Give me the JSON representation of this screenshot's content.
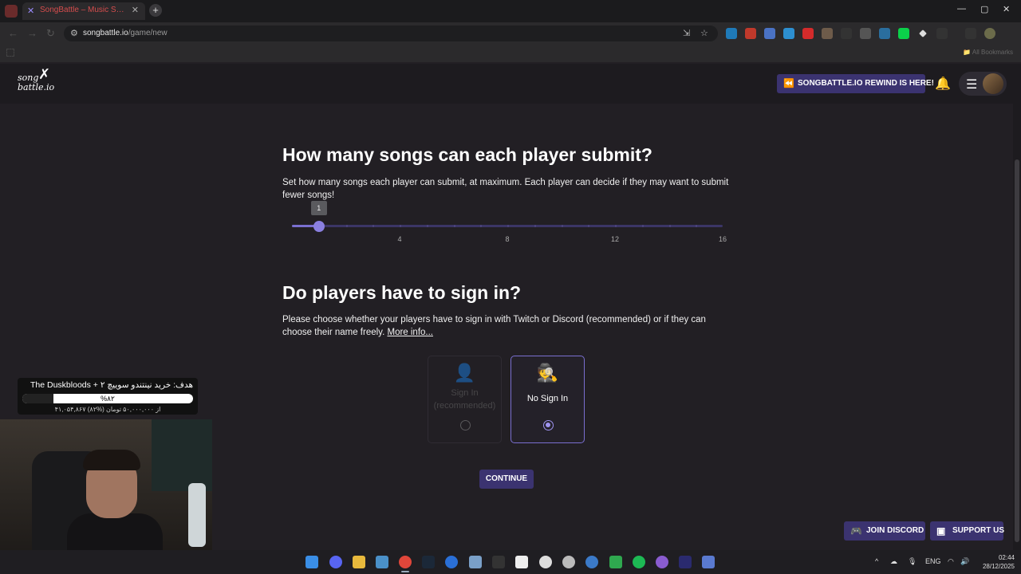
{
  "browser": {
    "tab_title": "SongBattle – Music Song Battle",
    "url_host": "songbattle.io",
    "url_path": "/game/new",
    "all_bookmarks": "All Bookmarks",
    "window_controls": {
      "minimize": "—",
      "maximize": "▢",
      "close": "✕"
    }
  },
  "site": {
    "logo_text_1": "song",
    "logo_text_2": "battle.io",
    "rewind_label": "SONGBATTLE.IO REWIND IS HERE!",
    "icons": {
      "rewind": "rewind-icon",
      "bell": "bell-icon",
      "menu": "menu-icon"
    }
  },
  "songs_section": {
    "title": "How many songs can each player submit?",
    "description": "Set how many songs each player can submit, at maximum. Each player can decide if they may want to submit fewer songs!",
    "slider": {
      "min": 0,
      "max": 16,
      "value": 1,
      "value_label": "1",
      "marks": [
        "4",
        "8",
        "12",
        "16"
      ]
    }
  },
  "signin_section": {
    "title": "Do players have to sign in?",
    "description": "Please choose whether your players have to sign in with Twitch or Discord (recommended) or if they can choose their name freely.",
    "more_info": "More info...",
    "options": [
      {
        "label": "Sign In (recommended)",
        "icon": "user-icon",
        "selected": false,
        "disabled": true
      },
      {
        "label": "No Sign In",
        "icon": "incognito-icon",
        "selected": true,
        "disabled": false
      }
    ],
    "continue_label": "CONTINUE"
  },
  "footer": {
    "join_discord": "JOIN DISCORD",
    "support_us": "SUPPORT US"
  },
  "stream_overlay": {
    "goal_title": "هدف: خرید نینتندو سوییچ ۲ + The Duskbloods",
    "goal_percent_label": "%۸۲",
    "goal_progress": 0.82,
    "goal_sub": "۴۱,۰۵۴,۸۶۷ از ۵۰,۰۰۰,۰۰۰ تومان (%۸۲)"
  },
  "taskbar": {
    "lang": "ENG",
    "time": "02:44",
    "date": "28/12/2025"
  },
  "colors": {
    "accent": "#3b3370",
    "accent_light": "#7a6fd0",
    "page_bg": "#221f24"
  }
}
